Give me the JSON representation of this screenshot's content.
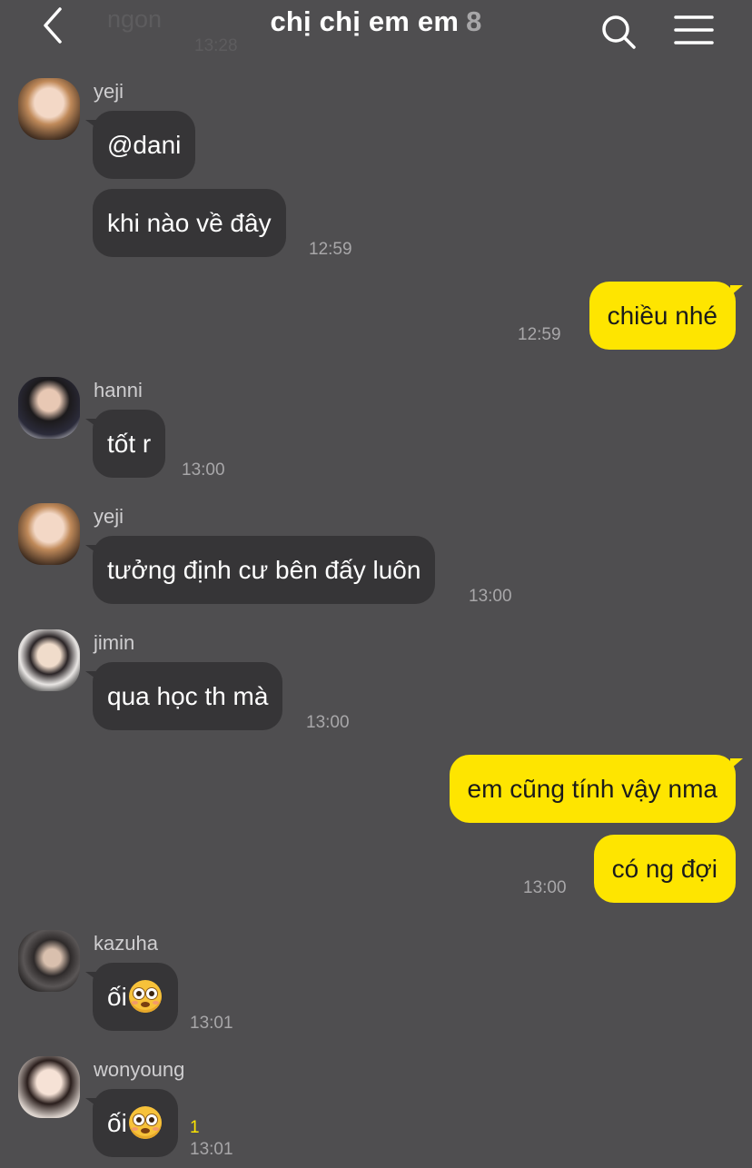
{
  "header": {
    "title": "chị chị em em",
    "member_count": "8",
    "ghost_name": "ngon",
    "ghost_time": "13:28",
    "back_icon": "chevron-left-icon",
    "search_icon": "search-icon",
    "menu_icon": "hamburger-menu-icon"
  },
  "colors": {
    "background": "#4f4e50",
    "incoming_bubble": "#363537",
    "outgoing_bubble": "#fee500",
    "unread": "#fee500"
  },
  "messages": [
    {
      "sender": "yeji",
      "texts": [
        "@dani",
        "khi nào về đây"
      ],
      "time": "12:59"
    },
    {
      "mine": true,
      "texts": [
        "chiều nhé"
      ],
      "time": "12:59"
    },
    {
      "sender": "hanni",
      "texts": [
        "tốt r"
      ],
      "time": "13:00"
    },
    {
      "sender": "yeji",
      "texts": [
        "tưởng định cư bên đấy luôn"
      ],
      "time": "13:00"
    },
    {
      "sender": "jimin",
      "texts": [
        "qua học th mà"
      ],
      "time": "13:00"
    },
    {
      "mine": true,
      "texts": [
        "em cũng tính vậy nma",
        "có ng đợi"
      ],
      "time": "13:00"
    },
    {
      "sender": "kazuha",
      "texts": [
        "ối"
      ],
      "emoji": "flushed-face-emoji",
      "time": "13:01"
    },
    {
      "sender": "wonyoung",
      "texts": [
        "ối"
      ],
      "emoji": "flushed-face-emoji",
      "unread": "1",
      "time": "13:01"
    }
  ]
}
